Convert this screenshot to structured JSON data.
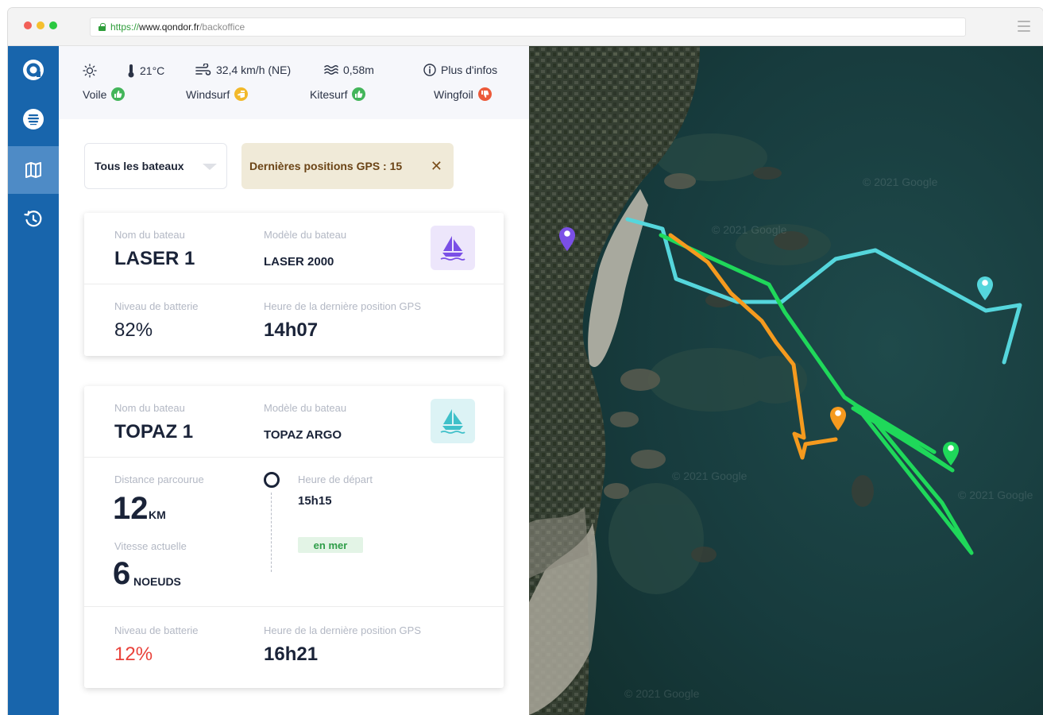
{
  "browser": {
    "url_scheme": "https://",
    "url_host": "www.qondor.fr",
    "url_path": "/backoffice"
  },
  "colors": {
    "sidebar": "#1865ac",
    "sidebar_active": "#4e8bc6",
    "track_cyan": "#55d6dc",
    "track_green": "#1fd85a",
    "track_orange": "#f59a1e",
    "pin_purple": "#7a4fe6",
    "good": "#43b55a",
    "medium": "#f2b92b",
    "bad": "#ec5a3a",
    "battery_low": "#e9413a"
  },
  "sidebar": {
    "items": [
      {
        "name": "logo",
        "icon": "qondor-logo-icon"
      },
      {
        "name": "fleet",
        "icon": "boat-stack-icon"
      },
      {
        "name": "map",
        "icon": "map-icon",
        "active": true
      },
      {
        "name": "history",
        "icon": "history-icon"
      }
    ]
  },
  "weather": {
    "temperature": "21°C",
    "wind": "32,4 km/h (NE)",
    "waves": "0,58m",
    "more_info": "Plus d'infos",
    "sports": [
      {
        "name": "Voile",
        "rating": "good"
      },
      {
        "name": "Windsurf",
        "rating": "medium"
      },
      {
        "name": "Kitesurf",
        "rating": "good"
      },
      {
        "name": "Wingfoil",
        "rating": "bad"
      }
    ]
  },
  "filters": {
    "boat_select": "Tous les bateaux",
    "gps_chip": "Dernières positions GPS : 15"
  },
  "boats": [
    {
      "name_label": "Nom du bateau",
      "name": "LASER 1",
      "model_label": "Modèle du bateau",
      "model": "LASER 2000",
      "battery_label": "Niveau de batterie",
      "battery": "82%",
      "last_gps_label": "Heure de la dernière position GPS",
      "last_gps": "14h07"
    },
    {
      "name_label": "Nom du bateau",
      "name": "TOPAZ 1",
      "model_label": "Modèle du bateau",
      "model": "TOPAZ ARGO",
      "distance_label": "Distance parcourue",
      "distance": "12",
      "distance_unit": "KM",
      "speed_label": "Vitesse actuelle",
      "speed": "6",
      "speed_unit": "NOEUDS",
      "departure_label": "Heure de départ",
      "departure": "15h15",
      "status": "en mer",
      "battery_label": "Niveau de batterie",
      "battery": "12%",
      "last_gps_label": "Heure de la dernière position GPS",
      "last_gps": "16h21"
    }
  ],
  "map": {
    "watermark": "© 2021 Google"
  }
}
